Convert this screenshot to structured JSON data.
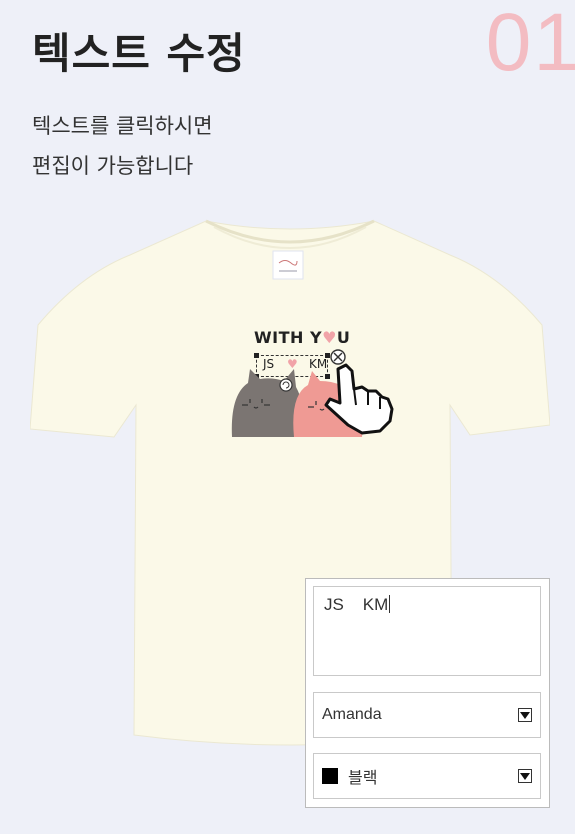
{
  "step_number": "01",
  "title": "텍스트 수정",
  "description": [
    "텍스트를 클릭하시면",
    "편집이 가능합니다"
  ],
  "design": {
    "title_left": "WITH Y",
    "title_heart": "♥",
    "title_right": "U",
    "text_left": "JS",
    "text_heart": "♥",
    "text_right": "KM"
  },
  "editor": {
    "text_value": "JS    KM",
    "font_value": "Amanda",
    "color_value": "블랙",
    "color_swatch": "#000000"
  },
  "colors": {
    "background": "#eef0f8",
    "shirt": "#fbf9e8",
    "accent_pink": "#f3bcc2",
    "cat_gray": "#7b7572",
    "cat_pink": "#ef9a94"
  }
}
